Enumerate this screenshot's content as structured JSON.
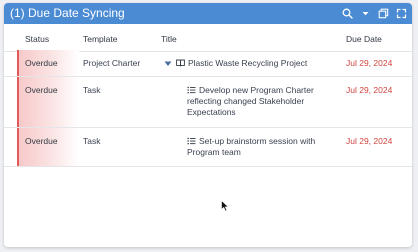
{
  "panel": {
    "title": "(1) Due Date Syncing",
    "icons": [
      "search-icon",
      "chevron-down-icon",
      "copy-icon",
      "expand-icon"
    ]
  },
  "columns": {
    "status": "Status",
    "template": "Template",
    "title": "Title",
    "due_date": "Due Date"
  },
  "rows": [
    {
      "status": "Overdue",
      "template": "Project Charter",
      "title_lines": [
        "Plastic Waste Recycling Project"
      ],
      "title_icon": "book-icon",
      "due_date": "Jul 29, 2024",
      "expandable": true
    },
    {
      "status": "Overdue",
      "template": "Task",
      "title_lines": [
        "Develop new Program Charter",
        "reflecting changed Stakeholder",
        "Expectations"
      ],
      "title_icon": "list-icon",
      "due_date": "Jul 29, 2024",
      "expandable": false
    },
    {
      "status": "Overdue",
      "template": "Task",
      "title_lines": [
        "Set-up brainstorm session with",
        "Program team"
      ],
      "title_icon": "list-icon",
      "due_date": "Jul 29, 2024",
      "expandable": false
    }
  ],
  "colors": {
    "titlebar": "#4a8bd4",
    "overdue_accent": "#e05a5a",
    "due_date_text": "#d0433f"
  }
}
